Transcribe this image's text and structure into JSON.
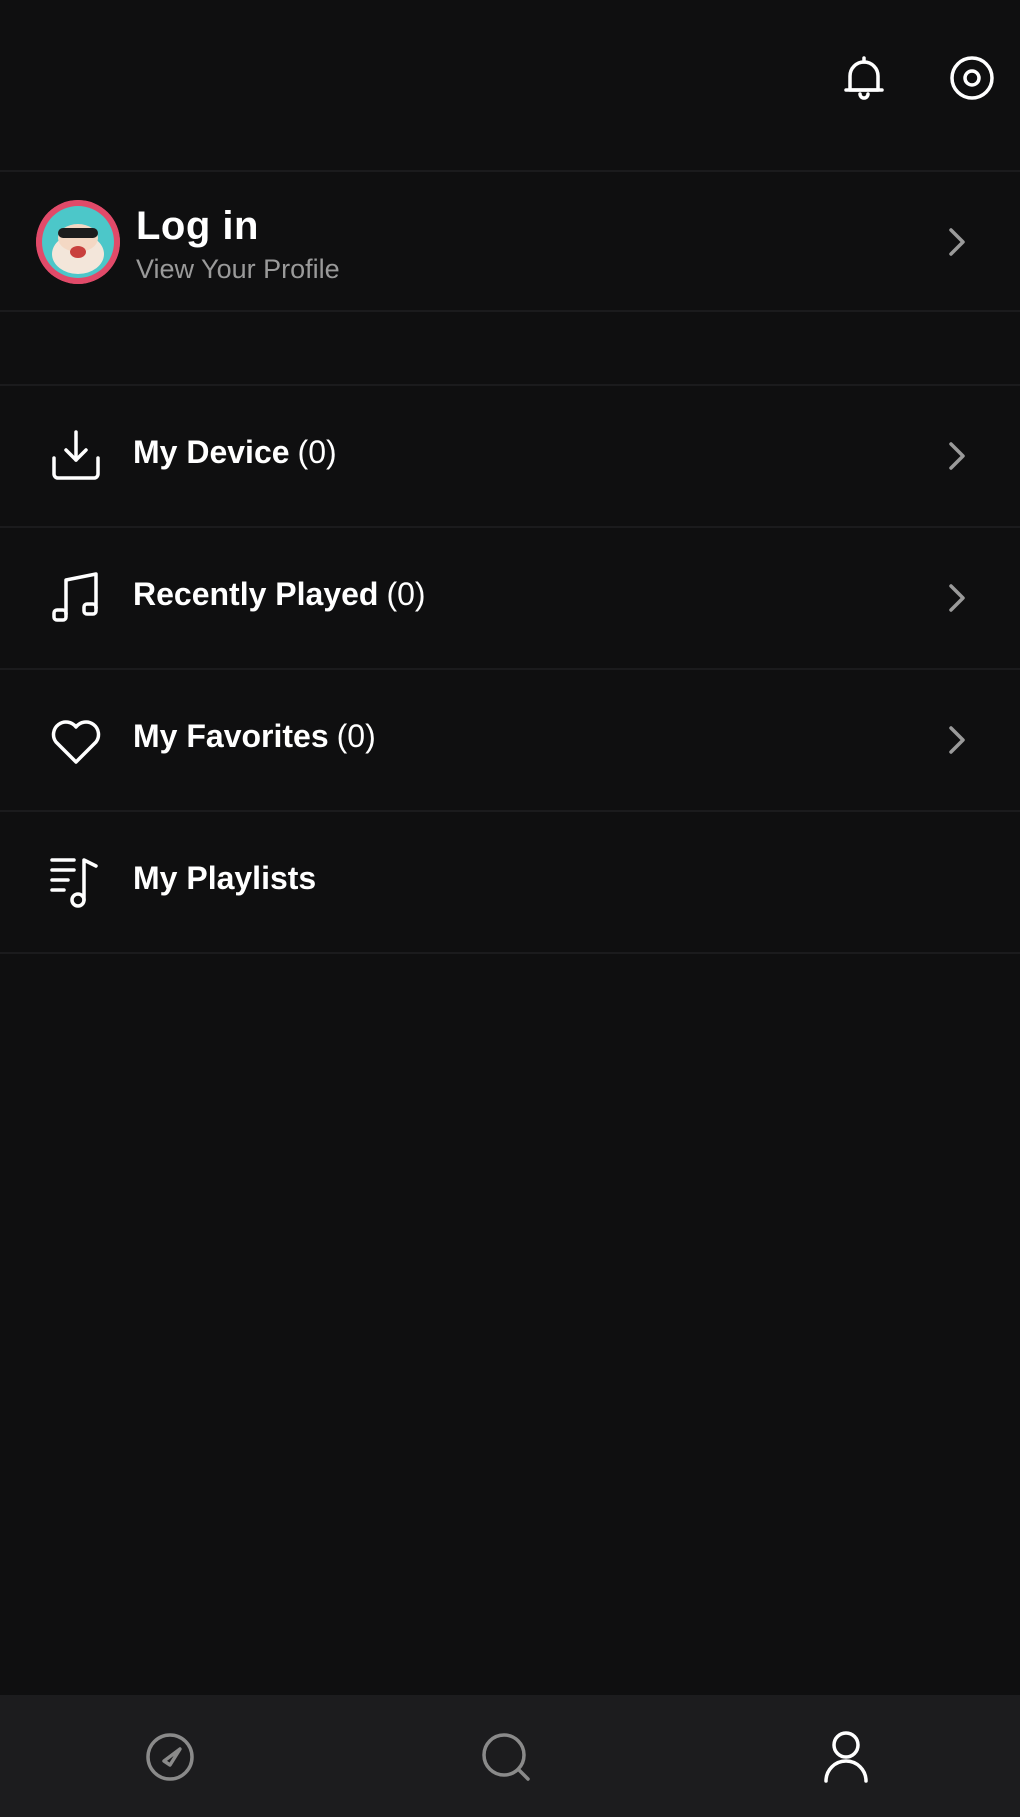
{
  "header": {
    "icons": [
      "bell-icon",
      "settings-icon"
    ]
  },
  "profile": {
    "title": "Log in",
    "subtitle": "View Your Profile"
  },
  "menu": {
    "items": [
      {
        "label": "My Device",
        "count": "(0)",
        "icon": "download-icon",
        "has_chevron": true
      },
      {
        "label": "Recently Played",
        "count": "(0)",
        "icon": "music-note-icon",
        "has_chevron": true
      },
      {
        "label": "My Favorites",
        "count": "(0)",
        "icon": "heart-icon",
        "has_chevron": true
      },
      {
        "label": "My Playlists",
        "count": "",
        "icon": "playlist-icon",
        "has_chevron": false
      }
    ]
  },
  "bottom_nav": {
    "items": [
      {
        "icon": "discover-icon",
        "active": false
      },
      {
        "icon": "search-icon",
        "active": false
      },
      {
        "icon": "profile-icon",
        "active": true
      }
    ]
  },
  "colors": {
    "background": "#0f0f10",
    "nav_background": "#1c1c1e",
    "text_primary": "#ffffff",
    "text_secondary": "#9a9a9a",
    "icon_inactive": "#8a8a8a",
    "avatar_accent": "#e14a69"
  }
}
